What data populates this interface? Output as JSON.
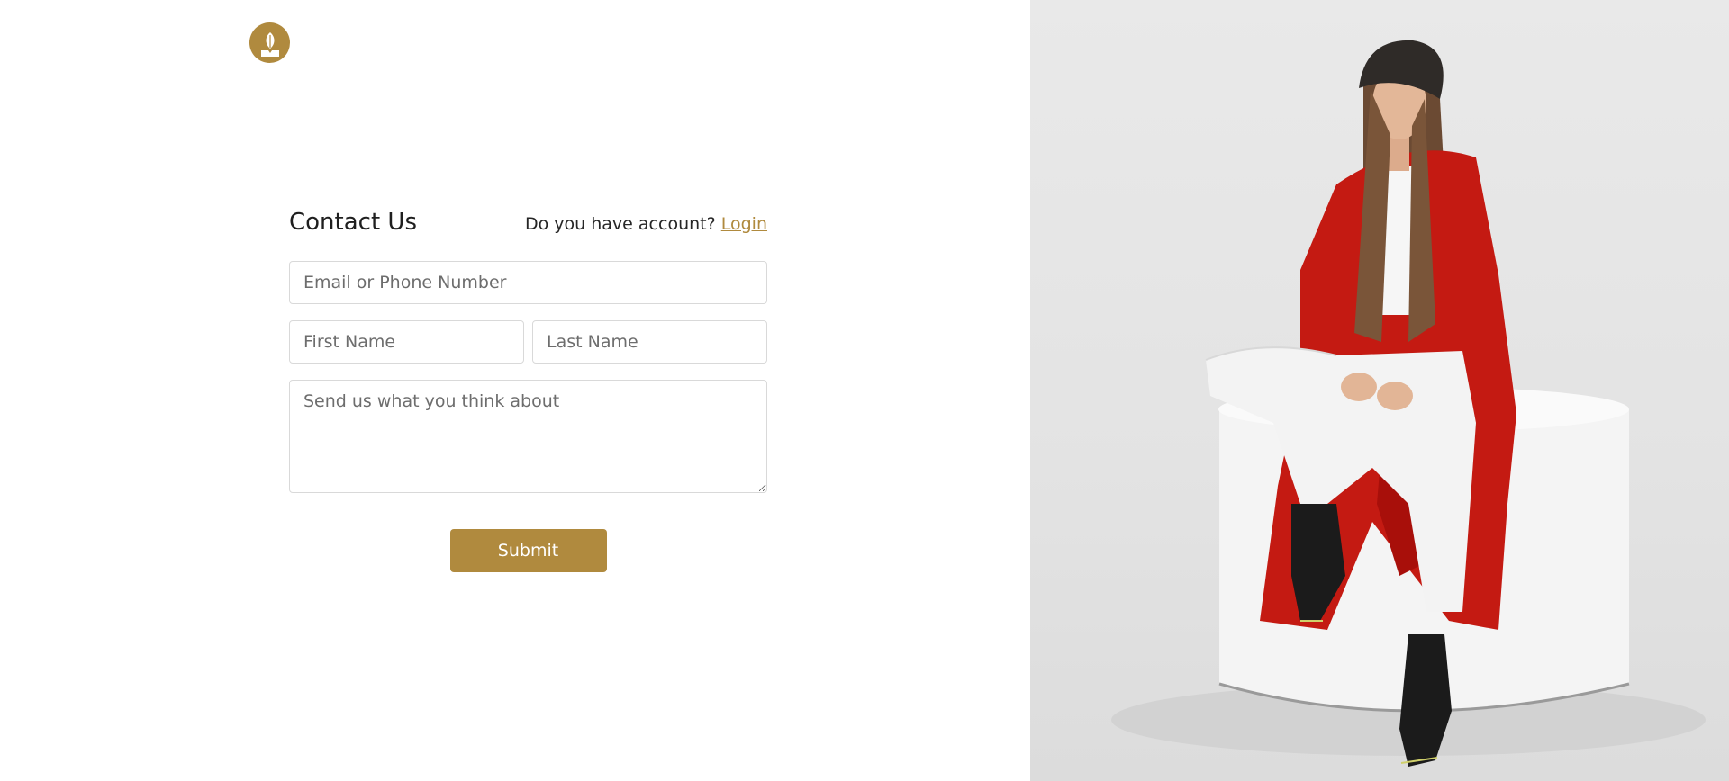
{
  "form": {
    "title": "Contact Us",
    "account_prompt": "Do you have account?",
    "login_label": "Login",
    "email_placeholder": "Email or Phone Number",
    "first_name_placeholder": "First Name",
    "last_name_placeholder": "Last Name",
    "message_placeholder": "Send us what you think about",
    "submit_label": "Submit"
  },
  "brand": {
    "logo_icon": "leaf-book-icon",
    "accent_color": "#b08a3e"
  },
  "hero": {
    "image": "woman-in-red-coat-photo",
    "background_color": "#e5e5e5"
  }
}
